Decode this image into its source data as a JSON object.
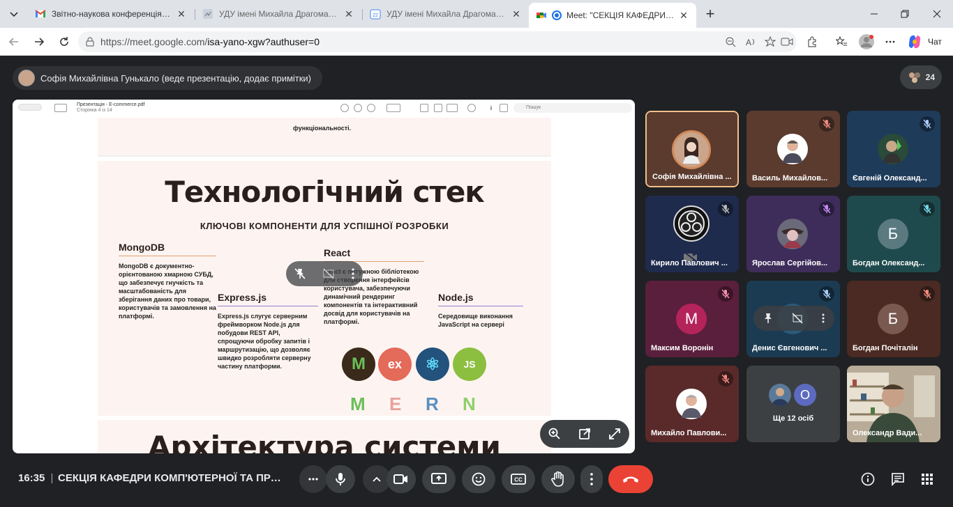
{
  "tabs": [
    {
      "title": "Звітно-наукова конференція стаді",
      "icon": "gmail-icon"
    },
    {
      "title": "УДУ імені Михайла Драгоманова",
      "icon": "page-icon"
    },
    {
      "title": "УДУ імені Михайла Драгоманова",
      "icon": "calendar-icon"
    },
    {
      "title": "Meet: \"СЕКЦІЯ КАФЕДРИ КОМ",
      "icon": "meet-icon",
      "active": true
    }
  ],
  "address": {
    "host": "https://meet.google.com/",
    "path": "isa-yano-xgw?authuser=0"
  },
  "copilot_label": "Чат",
  "meet": {
    "presenter_label": "Софія Михайлівна Гунькало (веде презентацію, додає примітки)",
    "people_count": "24",
    "time": "16:35",
    "separator": "|",
    "meeting_title": "СЕКЦІЯ КАФЕДРИ КОМП'ЮТЕРНОЇ ТА ПРОГР..."
  },
  "pdf": {
    "title": "Презентація - E-commerce.pdf",
    "page": "Сторінка 4 із 14",
    "search_placeholder": "Пошук"
  },
  "slide_prev_text": "функціональності.",
  "slide": {
    "title": "Технологічний стек",
    "subtitle": "КЛЮЧОВІ КОМПОНЕНТИ ДЛЯ УСПІШНОЇ РОЗРОБКИ",
    "columns": [
      {
        "heading": "MongoDB",
        "text": "MongoDB є документно-орієнтованою хмарною СУБД, що забезпечує гнучкість та масштабованість для зберігання даних про товари, користувачів та замовлення на платформі."
      },
      {
        "heading": "Express.js",
        "text": "Express.js слугує серверним фреймворком Node.js для побудови REST API, спрощуючи обробку запитів і маршрутизацію, що дозволяє швидко розробляти серверну частину платформи."
      },
      {
        "heading": "React",
        "text": "React є потужною бібліотекою для створення інтерфейсів користувача, забезпечуючи динамічний рендеринг компонентів та інтерактивний досвід для користувачів на платформі."
      },
      {
        "heading": "Node.js",
        "text": "Середовище виконання JavaScript на сервері"
      }
    ],
    "logos": [
      "M",
      "ex",
      "⚛",
      "JS"
    ],
    "mern": [
      "M",
      "E",
      "R",
      "N"
    ],
    "mern_colors": [
      "#6bbf5a",
      "#e8a09a",
      "#5a8fbf",
      "#8fcf6a"
    ]
  },
  "slide_next_title": "Архітектура системи",
  "participants": [
    {
      "name": "Софія Михайлівна ...",
      "bg": "#5a3b2e",
      "avatar": "photo",
      "initial": "",
      "muted": false,
      "highlight": true
    },
    {
      "name": "Василь Михайлов...",
      "bg": "#5a3b2e",
      "avatar": "photo",
      "initial": "",
      "muted": true
    },
    {
      "name": "Євгеній Олександ...",
      "bg": "#1e3b5a",
      "avatar": "photo",
      "initial": "",
      "muted": true
    },
    {
      "name": "Кирило Павлович ...",
      "bg": "#1f2b4d",
      "avatar": "obs",
      "initial": "",
      "muted": true
    },
    {
      "name": "Ярослав Сергійов...",
      "bg": "#3e2d5a",
      "avatar": "photo",
      "initial": "",
      "muted": true
    },
    {
      "name": "Богдан Олександ...",
      "bg": "#1f4a4d",
      "avatar": "letter",
      "initial": "Б",
      "avatar_bg": "#5a7a80",
      "muted": true
    },
    {
      "name": "Максим Воронін",
      "bg": "#5a1f3c",
      "avatar": "letter",
      "initial": "M",
      "avatar_bg": "#b4245a",
      "muted": true
    },
    {
      "name": "Денис Євгенович ...",
      "bg": "#1b3b52",
      "avatar": "letter",
      "initial": "",
      "avatar_bg": "#2c5a7a",
      "muted": true
    },
    {
      "name": "Богдан Почіталін",
      "bg": "#4a2a22",
      "avatar": "letter",
      "initial": "Б",
      "avatar_bg": "#7a5a50",
      "muted": true
    },
    {
      "name": "Михайло Павлови...",
      "bg": "#5a2a2a",
      "avatar": "photo",
      "initial": "",
      "muted": true
    },
    {
      "name": "Ще 12 осіб",
      "bg": "#3c4043",
      "avatar": "more",
      "initial": "O",
      "muted": false
    },
    {
      "name": "Олександр Вади...",
      "bg": "#7a6a50",
      "avatar": "video",
      "initial": "",
      "muted": false
    }
  ],
  "colors": {
    "end_call": "#ea4335",
    "presenter_border": "#f3c08a",
    "meet_bg": "#202124"
  }
}
